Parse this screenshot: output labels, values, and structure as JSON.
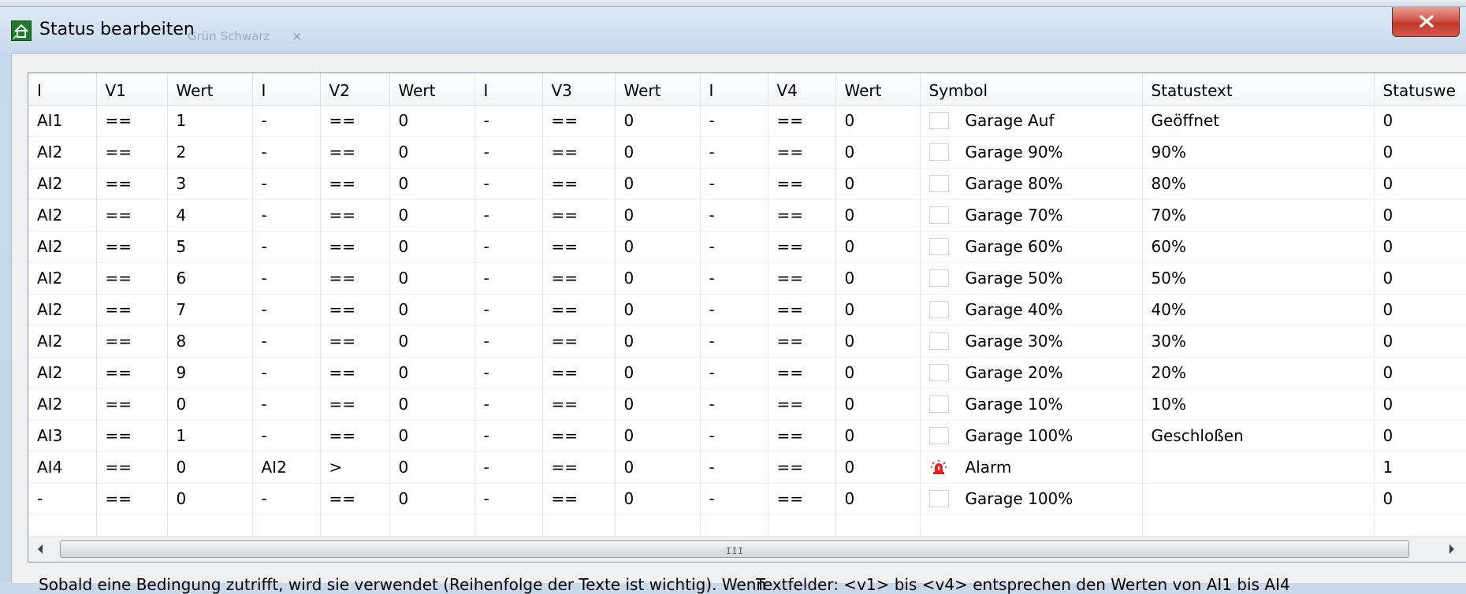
{
  "window": {
    "title": "Status bearbeiten",
    "ghost_tab_label": "Grün Schwarz",
    "ghost_tab_close": "×"
  },
  "columns": [
    "I",
    "V1",
    "Wert",
    "I",
    "V2",
    "Wert",
    "I",
    "V3",
    "Wert",
    "I",
    "V4",
    "Wert",
    "Symbol",
    "Statustext",
    "Statuswe"
  ],
  "rows": [
    {
      "i1": "AI1",
      "v1": "==",
      "w1": "1",
      "i2": "-",
      "v2": "==",
      "w2": "0",
      "i3": "-",
      "v3": "==",
      "w3": "0",
      "i4": "-",
      "v4": "==",
      "w4": "0",
      "symbol": "Garage Auf",
      "symbol_icon": "empty-box-icon",
      "statustext": "Geöffnet",
      "statuswert": "0"
    },
    {
      "i1": "AI2",
      "v1": "==",
      "w1": "2",
      "i2": "-",
      "v2": "==",
      "w2": "0",
      "i3": "-",
      "v3": "==",
      "w3": "0",
      "i4": "-",
      "v4": "==",
      "w4": "0",
      "symbol": "Garage 90%",
      "symbol_icon": "empty-box-icon",
      "statustext": "90%",
      "statuswert": "0"
    },
    {
      "i1": "AI2",
      "v1": "==",
      "w1": "3",
      "i2": "-",
      "v2": "==",
      "w2": "0",
      "i3": "-",
      "v3": "==",
      "w3": "0",
      "i4": "-",
      "v4": "==",
      "w4": "0",
      "symbol": "Garage 80%",
      "symbol_icon": "empty-box-icon",
      "statustext": "80%",
      "statuswert": "0"
    },
    {
      "i1": "AI2",
      "v1": "==",
      "w1": "4",
      "i2": "-",
      "v2": "==",
      "w2": "0",
      "i3": "-",
      "v3": "==",
      "w3": "0",
      "i4": "-",
      "v4": "==",
      "w4": "0",
      "symbol": "Garage 70%",
      "symbol_icon": "empty-box-icon",
      "statustext": "70%",
      "statuswert": "0"
    },
    {
      "i1": "AI2",
      "v1": "==",
      "w1": "5",
      "i2": "-",
      "v2": "==",
      "w2": "0",
      "i3": "-",
      "v3": "==",
      "w3": "0",
      "i4": "-",
      "v4": "==",
      "w4": "0",
      "symbol": "Garage 60%",
      "symbol_icon": "empty-box-icon",
      "statustext": "60%",
      "statuswert": "0"
    },
    {
      "i1": "AI2",
      "v1": "==",
      "w1": "6",
      "i2": "-",
      "v2": "==",
      "w2": "0",
      "i3": "-",
      "v3": "==",
      "w3": "0",
      "i4": "-",
      "v4": "==",
      "w4": "0",
      "symbol": "Garage 50%",
      "symbol_icon": "empty-box-icon",
      "statustext": "50%",
      "statuswert": "0"
    },
    {
      "i1": "AI2",
      "v1": "==",
      "w1": "7",
      "i2": "-",
      "v2": "==",
      "w2": "0",
      "i3": "-",
      "v3": "==",
      "w3": "0",
      "i4": "-",
      "v4": "==",
      "w4": "0",
      "symbol": "Garage 40%",
      "symbol_icon": "empty-box-icon",
      "statustext": "40%",
      "statuswert": "0"
    },
    {
      "i1": "AI2",
      "v1": "==",
      "w1": "8",
      "i2": "-",
      "v2": "==",
      "w2": "0",
      "i3": "-",
      "v3": "==",
      "w3": "0",
      "i4": "-",
      "v4": "==",
      "w4": "0",
      "symbol": "Garage 30%",
      "symbol_icon": "empty-box-icon",
      "statustext": "30%",
      "statuswert": "0"
    },
    {
      "i1": "AI2",
      "v1": "==",
      "w1": "9",
      "i2": "-",
      "v2": "==",
      "w2": "0",
      "i3": "-",
      "v3": "==",
      "w3": "0",
      "i4": "-",
      "v4": "==",
      "w4": "0",
      "symbol": "Garage 20%",
      "symbol_icon": "empty-box-icon",
      "statustext": "20%",
      "statuswert": "0"
    },
    {
      "i1": "AI2",
      "v1": "==",
      "w1": "0",
      "i2": "-",
      "v2": "==",
      "w2": "0",
      "i3": "-",
      "v3": "==",
      "w3": "0",
      "i4": "-",
      "v4": "==",
      "w4": "0",
      "symbol": "Garage 10%",
      "symbol_icon": "empty-box-icon",
      "statustext": "10%",
      "statuswert": "0"
    },
    {
      "i1": "AI3",
      "v1": "==",
      "w1": "1",
      "i2": "-",
      "v2": "==",
      "w2": "0",
      "i3": "-",
      "v3": "==",
      "w3": "0",
      "i4": "-",
      "v4": "==",
      "w4": "0",
      "symbol": "Garage 100%",
      "symbol_icon": "empty-box-icon",
      "statustext": "Geschloßen",
      "statuswert": "0"
    },
    {
      "i1": "AI4",
      "v1": "==",
      "w1": "0",
      "i2": "AI2",
      "v2": ">",
      "w2": "0",
      "i3": "-",
      "v3": "==",
      "w3": "0",
      "i4": "-",
      "v4": "==",
      "w4": "0",
      "symbol": "Alarm",
      "symbol_icon": "alarm-siren-icon",
      "statustext": "",
      "statuswert": "1"
    },
    {
      "i1": "-",
      "v1": "==",
      "w1": "0",
      "i2": "-",
      "v2": "==",
      "w2": "0",
      "i3": "-",
      "v3": "==",
      "w3": "0",
      "i4": "-",
      "v4": "==",
      "w4": "0",
      "symbol": "Garage 100%",
      "symbol_icon": "empty-box-icon",
      "statustext": "",
      "statuswert": "0"
    }
  ],
  "scrollbar": {
    "grip": "III"
  },
  "hints": {
    "left": "Sobald eine Bedingung zutrifft, wird sie verwendet (Reihenfolge der Texte ist wichtig). Wenn",
    "right": "Textfelder: <v1> bis <v4> entsprechen den Werten von AI1 bis AI4"
  },
  "colors": {
    "close_button": "#c7453a",
    "alarm_icon": "#e8201c",
    "app_icon": "#1f7a2a"
  }
}
